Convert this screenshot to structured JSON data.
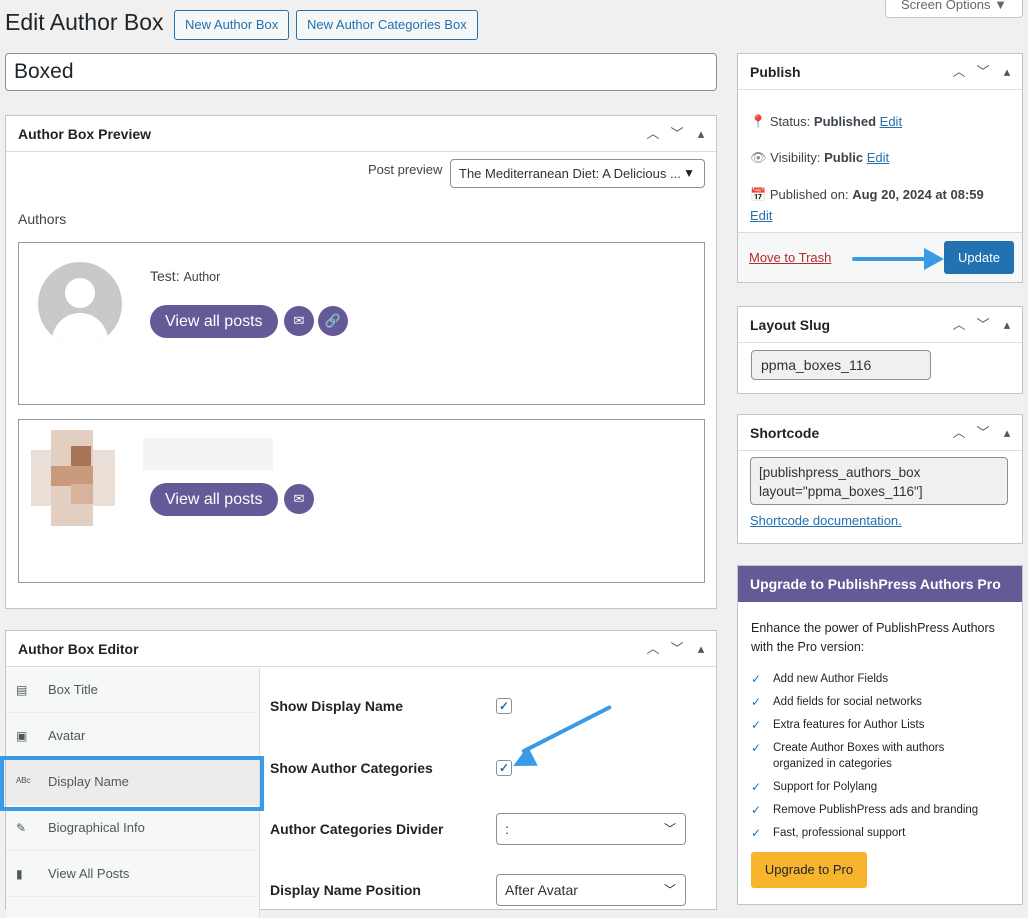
{
  "page": {
    "title": "Edit Author Box",
    "new_author_box": "New Author Box",
    "new_categories_box": "New Author Categories Box",
    "screen_options": "Screen Options",
    "box_name": "Boxed"
  },
  "preview": {
    "heading": "Author Box Preview",
    "post_preview_label": "Post preview",
    "post_preview_value": "The Mediterranean Diet: A Delicious ...",
    "authors_label": "Authors",
    "author1_name": "Test",
    "author1_category": "Author",
    "view_all_posts": "View all posts",
    "view_all_posts_2": "View all posts"
  },
  "editor": {
    "heading": "Author Box Editor",
    "tabs": [
      {
        "label": "Box Title",
        "icon": "title-icon"
      },
      {
        "label": "Avatar",
        "icon": "image-icon"
      },
      {
        "label": "Display Name",
        "icon": "text-icon"
      },
      {
        "label": "Biographical Info",
        "icon": "edit-icon"
      },
      {
        "label": "View All Posts",
        "icon": "posts-icon"
      }
    ],
    "show_display_name": "Show Display Name",
    "show_author_categories": "Show Author Categories",
    "categories_divider": "Author Categories Divider",
    "categories_divider_value": ":",
    "display_name_position": "Display Name Position",
    "display_name_position_value": "After Avatar"
  },
  "publish": {
    "heading": "Publish",
    "status_label": "Status:",
    "status_value": "Published",
    "visibility_label": "Visibility:",
    "visibility_value": "Public",
    "published_on_label": "Published on:",
    "published_on_value": "Aug 20, 2024 at 08:59",
    "edit": "Edit",
    "move_to_trash": "Move to Trash",
    "update": "Update"
  },
  "layout_slug": {
    "heading": "Layout Slug",
    "value": "ppma_boxes_116"
  },
  "shortcode": {
    "heading": "Shortcode",
    "line1": "[publishpress_authors_box",
    "line2": "layout=\"ppma_boxes_116\"]",
    "doc_link": "Shortcode documentation."
  },
  "upgrade": {
    "heading": "Upgrade to PublishPress Authors Pro",
    "intro": "Enhance the power of PublishPress Authors with the Pro version:",
    "features": [
      "Add new Author Fields",
      "Add fields for social networks",
      "Extra features for Author Lists",
      "Create Author Boxes with authors organized in categories",
      "Support for Polylang",
      "Remove PublishPress ads and branding",
      "Fast, professional support"
    ],
    "button": "Upgrade to Pro"
  },
  "colors": {
    "accent": "#2271b1",
    "pill": "#655997",
    "upgrade_header": "#655997",
    "upgrade_button": "#f6b52c",
    "highlight": "#3b9ae6"
  }
}
